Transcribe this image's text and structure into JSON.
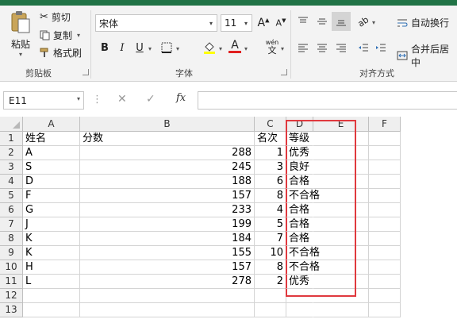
{
  "ribbon": {
    "clipboard": {
      "paste": "粘贴",
      "cut": "剪切",
      "copy": "复制",
      "format_painter": "格式刷",
      "label": "剪贴板"
    },
    "font": {
      "font_name": "宋体",
      "font_size": "11",
      "bold": "B",
      "italic": "I",
      "underline": "U",
      "font_color_glyph": "A",
      "phonetic_glyph": "wén",
      "label": "字体"
    },
    "alignment": {
      "wrap_text": "自动换行",
      "merge_center": "合并后居中",
      "label": "对齐方式"
    },
    "accent_color": "#217346"
  },
  "formula_bar": {
    "name_box": "E11",
    "cancel": "✕",
    "enter": "✓",
    "fx": "fx",
    "formula": ""
  },
  "sheet": {
    "columns": [
      "A",
      "B",
      "C",
      "D",
      "E",
      "F"
    ],
    "rows": [
      {
        "num": "1",
        "A": "姓名",
        "B": "分数",
        "C": "名次",
        "D": "等级"
      },
      {
        "num": "2",
        "A": "A",
        "B": "288",
        "C": "1",
        "D": "优秀"
      },
      {
        "num": "3",
        "A": "S",
        "B": "245",
        "C": "3",
        "D": "良好"
      },
      {
        "num": "4",
        "A": "D",
        "B": "188",
        "C": "6",
        "D": "合格"
      },
      {
        "num": "5",
        "A": "F",
        "B": "157",
        "C": "8",
        "D": "不合格"
      },
      {
        "num": "6",
        "A": "G",
        "B": "233",
        "C": "4",
        "D": "合格"
      },
      {
        "num": "7",
        "A": "J",
        "B": "199",
        "C": "5",
        "D": "合格"
      },
      {
        "num": "8",
        "A": "K",
        "B": "184",
        "C": "7",
        "D": "合格"
      },
      {
        "num": "9",
        "A": "K",
        "B": "155",
        "C": "10",
        "D": "不合格"
      },
      {
        "num": "10",
        "A": "H",
        "B": "157",
        "C": "8",
        "D": "不合格"
      },
      {
        "num": "11",
        "A": "L",
        "B": "278",
        "C": "2",
        "D": "优秀"
      },
      {
        "num": "12",
        "A": "",
        "B": "",
        "C": "",
        "D": ""
      },
      {
        "num": "13",
        "A": "",
        "B": "",
        "C": "",
        "D": ""
      }
    ],
    "highlight_color": "#e0393e"
  }
}
